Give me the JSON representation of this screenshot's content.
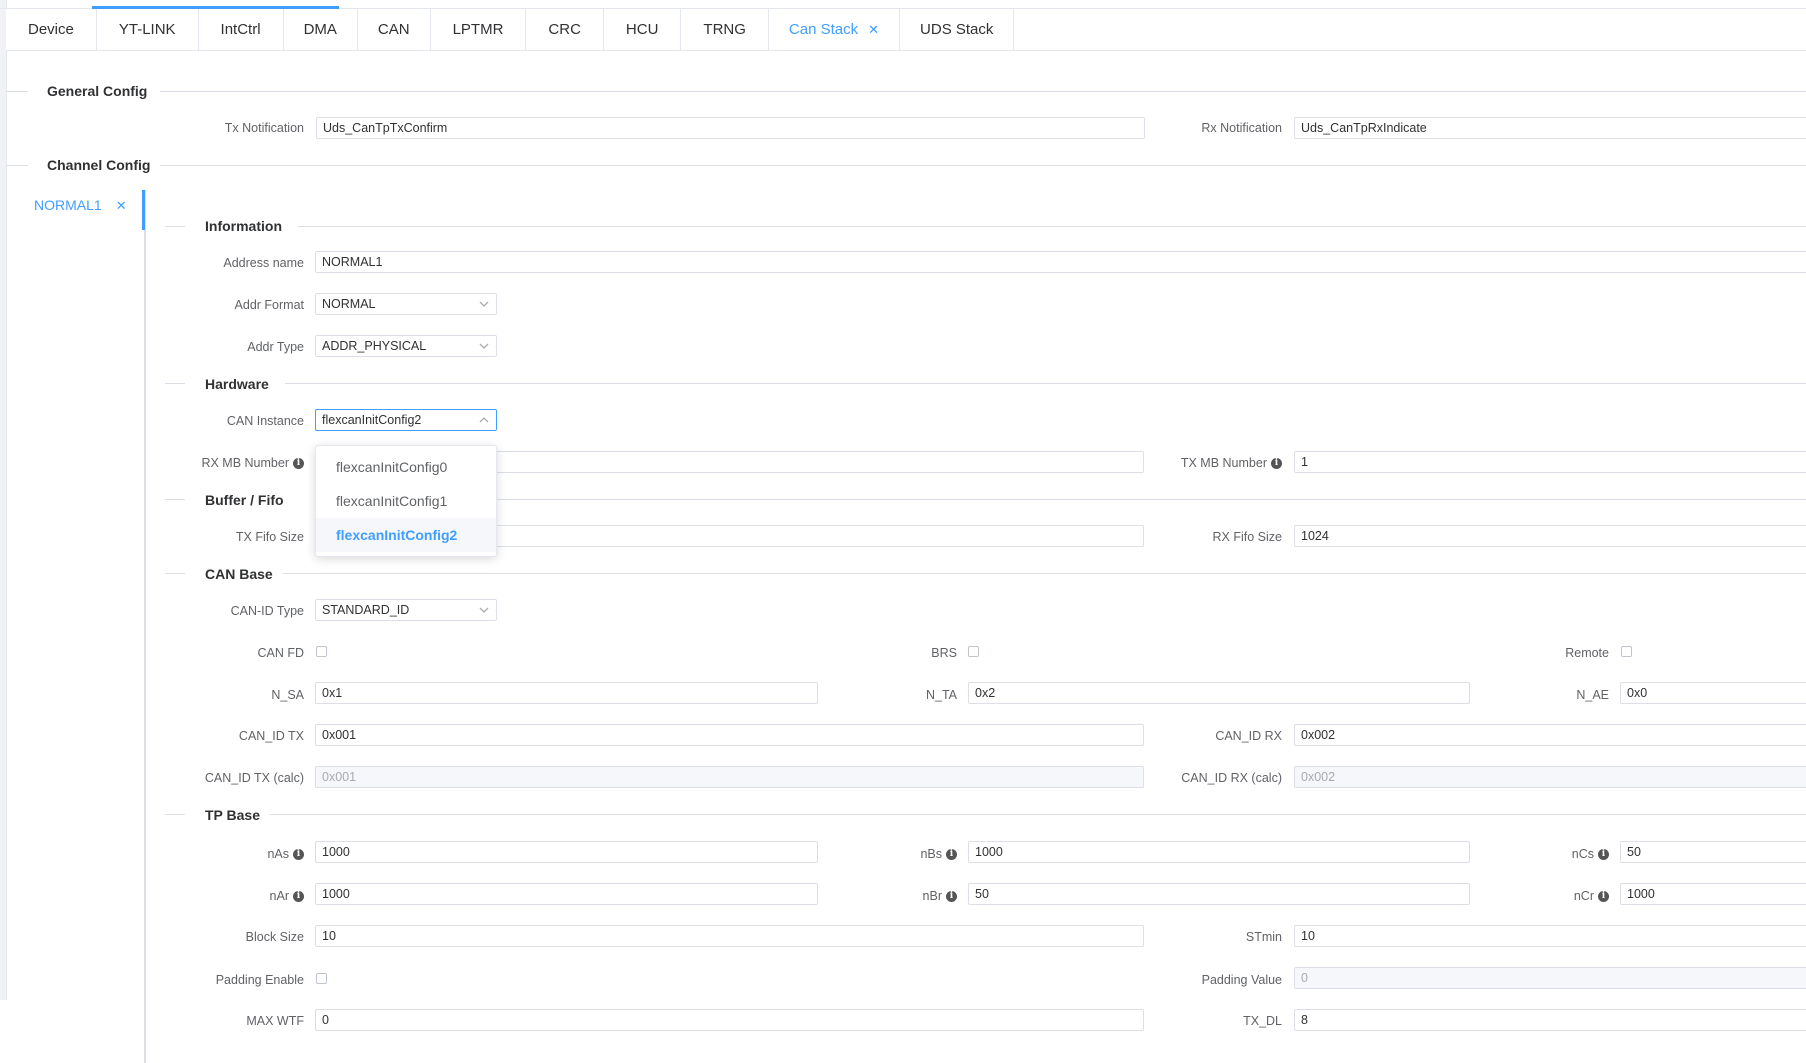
{
  "tabs": [
    {
      "label": "Device"
    },
    {
      "label": "YT-LINK"
    },
    {
      "label": "IntCtrl"
    },
    {
      "label": "DMA"
    },
    {
      "label": "CAN"
    },
    {
      "label": "LPTMR"
    },
    {
      "label": "CRC"
    },
    {
      "label": "HCU"
    },
    {
      "label": "TRNG"
    },
    {
      "label": "Can Stack",
      "closable": true
    },
    {
      "label": "UDS Stack"
    }
  ],
  "active_tab": "Can Stack",
  "general": {
    "title": "General Config",
    "tx_label": "Tx Notification",
    "tx_value": "Uds_CanTpTxConfirm",
    "rx_label": "Rx Notification",
    "rx_value": "Uds_CanTpRxIndicate"
  },
  "channel": {
    "title": "Channel Config",
    "item": "NORMAL1",
    "close": "×"
  },
  "information": {
    "title": "Information",
    "address_name_label": "Address name",
    "address_name_value": "NORMAL1",
    "addr_format_label": "Addr Format",
    "addr_format_value": "NORMAL",
    "addr_type_label": "Addr Type",
    "addr_type_value": "ADDR_PHYSICAL"
  },
  "hardware": {
    "title": "Hardware",
    "can_instance_label": "CAN Instance",
    "can_instance_value": "flexcanInitConfig2",
    "rx_mb_label": "RX MB Number",
    "rx_mb_value": "",
    "tx_mb_label": "TX MB Number",
    "tx_mb_value": "1"
  },
  "dropdown": {
    "options": [
      "flexcanInitConfig0",
      "flexcanInitConfig1",
      "flexcanInitConfig2"
    ],
    "selected": "flexcanInitConfig2"
  },
  "buffer": {
    "title": "Buffer / Fifo",
    "tx_fifo_label": "TX Fifo Size",
    "tx_fifo_value": "",
    "rx_fifo_label": "RX Fifo Size",
    "rx_fifo_value": "1024"
  },
  "canbase": {
    "title": "CAN Base",
    "canid_type_label": "CAN-ID Type",
    "canid_type_value": "STANDARD_ID",
    "canfd_label": "CAN FD",
    "brs_label": "BRS",
    "remote_label": "Remote",
    "nsa_label": "N_SA",
    "nsa_value": "0x1",
    "nta_label": "N_TA",
    "nta_value": "0x2",
    "nae_label": "N_AE",
    "nae_value": "0x0",
    "canid_tx_label": "CAN_ID TX",
    "canid_tx_value": "0x001",
    "canid_rx_label": "CAN_ID RX",
    "canid_rx_value": "0x002",
    "canid_tx_calc_label": "CAN_ID TX (calc)",
    "canid_tx_calc_value": "0x001",
    "canid_rx_calc_label": "CAN_ID RX (calc)",
    "canid_rx_calc_value": "0x002"
  },
  "tpbase": {
    "title": "TP Base",
    "nas_label": "nAs",
    "nas_value": "1000",
    "nbs_label": "nBs",
    "nbs_value": "1000",
    "ncs_label": "nCs",
    "ncs_value": "50",
    "nar_label": "nAr",
    "nar_value": "1000",
    "nbr_label": "nBr",
    "nbr_value": "50",
    "ncr_label": "nCr",
    "ncr_value": "1000",
    "block_size_label": "Block Size",
    "block_size_value": "10",
    "stmin_label": "STmin",
    "stmin_value": "10",
    "padding_enable_label": "Padding Enable",
    "padding_value_label": "Padding Value",
    "padding_value_value": "0",
    "max_wtf_label": "MAX WTF",
    "max_wtf_value": "0",
    "tx_dl_label": "TX_DL",
    "tx_dl_value": "8"
  }
}
